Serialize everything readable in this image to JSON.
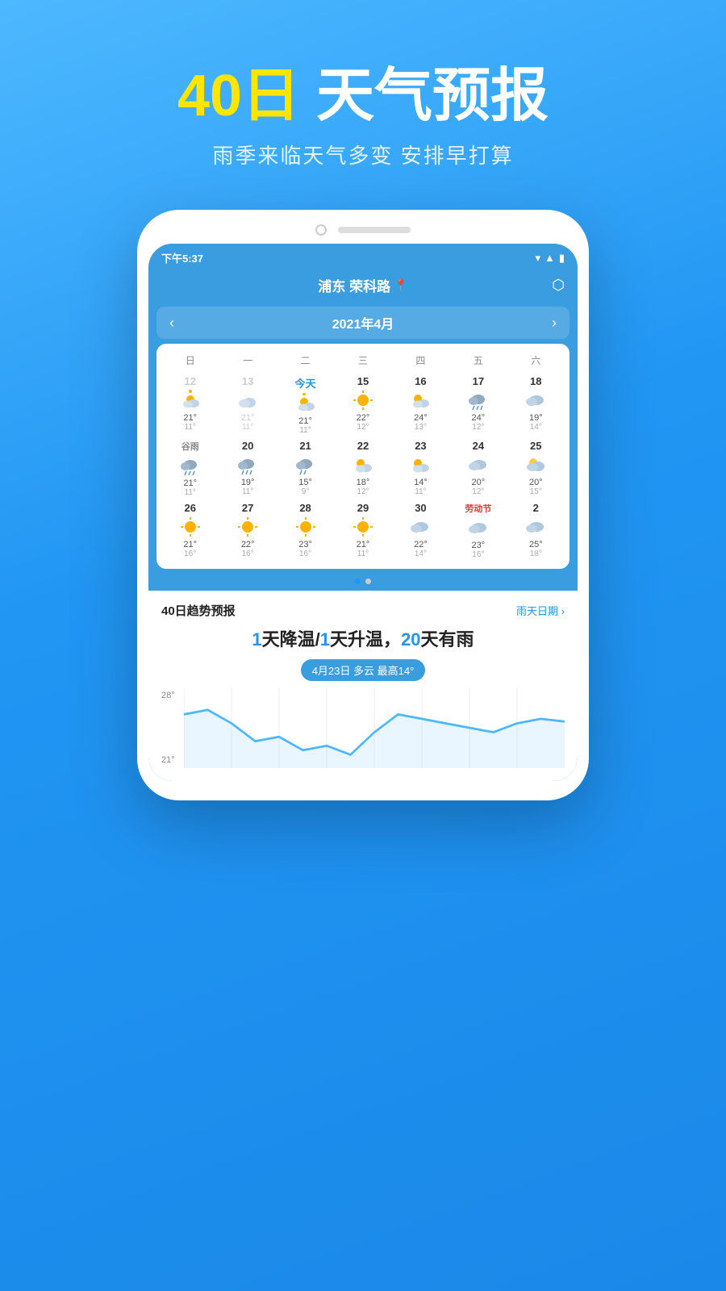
{
  "hero": {
    "title_highlight": "40日",
    "title_white": "天气预报",
    "subtitle": "雨季来临天气多变 安排早打算"
  },
  "app": {
    "status": {
      "time": "下午5:37"
    },
    "location": "浦东 荣科路",
    "month_nav": {
      "prev": "‹",
      "title": "2021年4月",
      "next": "›"
    },
    "calendar_headers": [
      "日",
      "一",
      "二",
      "三",
      "四",
      "五",
      "六"
    ],
    "weeks": [
      {
        "days": [
          {
            "day": "12",
            "weather": "partly",
            "high": "",
            "low": "",
            "empty": true
          },
          {
            "day": "13",
            "weather": "partly",
            "high": "",
            "low": "",
            "empty": true
          },
          {
            "day": "今天",
            "weather": "partly",
            "high": "21°",
            "low": "11°",
            "today": true
          },
          {
            "day": "15",
            "weather": "sunny",
            "high": "22°",
            "low": "12°"
          },
          {
            "day": "16",
            "weather": "partly",
            "high": "24°",
            "low": "13°"
          },
          {
            "day": "17",
            "weather": "rain",
            "high": "24°",
            "low": "12°"
          },
          {
            "day": "18",
            "weather": "cloudy",
            "high": "19°",
            "low": "14°"
          }
        ]
      },
      {
        "days": [
          {
            "day": "谷雨",
            "weather": "rain",
            "high": "21°",
            "low": "11°",
            "special": true
          },
          {
            "day": "20",
            "weather": "rain",
            "high": "19°",
            "low": "11°"
          },
          {
            "day": "21",
            "weather": "rain",
            "high": "15°",
            "low": "9°"
          },
          {
            "day": "22",
            "weather": "partly",
            "high": "18°",
            "low": "12°"
          },
          {
            "day": "23",
            "weather": "partly",
            "high": "14°",
            "low": "11°"
          },
          {
            "day": "24",
            "weather": "cloudy",
            "high": "20°",
            "low": "12°"
          },
          {
            "day": "25",
            "weather": "partly_cloud",
            "high": "20°",
            "low": "15°"
          }
        ]
      },
      {
        "days": [
          {
            "day": "26",
            "weather": "sunny",
            "high": "21°",
            "low": "16°"
          },
          {
            "day": "27",
            "weather": "sunny",
            "high": "22°",
            "low": "16°"
          },
          {
            "day": "28",
            "weather": "sunny",
            "high": "23°",
            "low": "16°"
          },
          {
            "day": "29",
            "weather": "sunny",
            "high": "21°",
            "low": "11°"
          },
          {
            "day": "30",
            "weather": "cloudy",
            "high": "22°",
            "low": "14°"
          },
          {
            "day": "劳动节",
            "weather": "cloudy",
            "high": "23°",
            "low": "16°",
            "holiday": true
          },
          {
            "day": "2",
            "weather": "cloudy",
            "high": "25°",
            "low": "18°"
          }
        ]
      }
    ],
    "trend": {
      "title": "40日趋势预报",
      "rain_link": "雨天日期 ›",
      "summary": "1天降温/1天升温，20天有雨",
      "badge": "4月23日 多云 最高14°",
      "chart_labels": [
        "28°",
        "21°"
      ],
      "chart_line_color": "#4db8ff"
    },
    "page_dots": [
      "active",
      "inactive"
    ]
  }
}
